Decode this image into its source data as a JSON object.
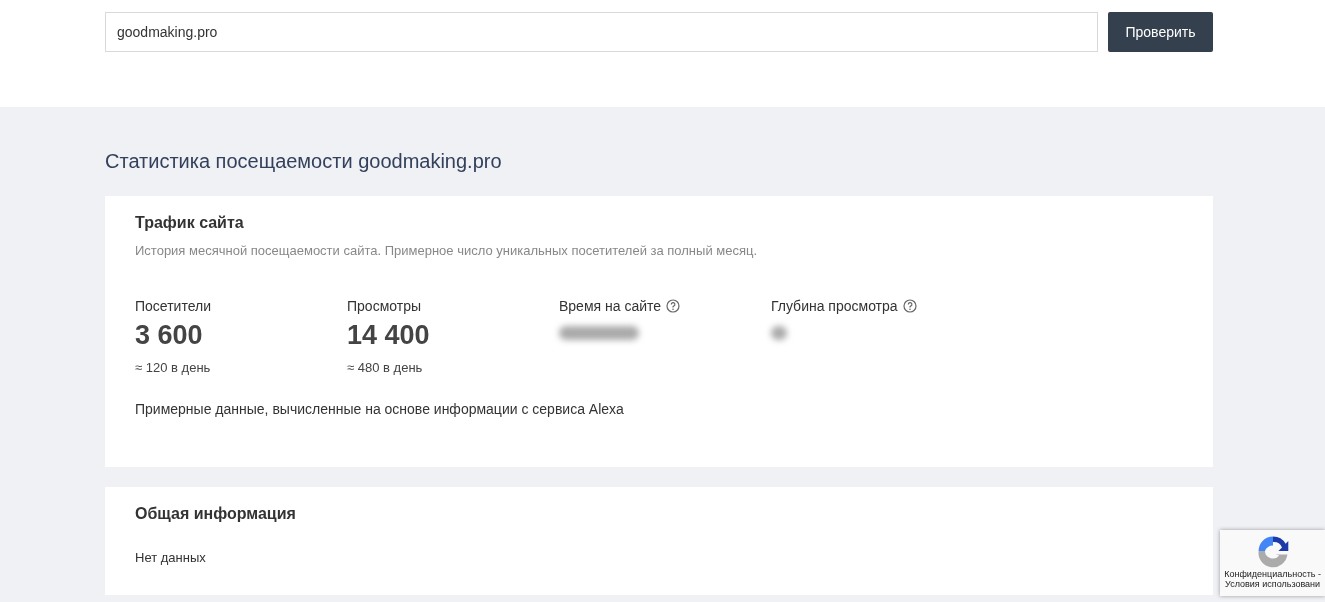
{
  "search": {
    "value": "goodmaking.pro",
    "button": "Проверить"
  },
  "heading": "Статистика посещаемости goodmaking.pro",
  "traffic": {
    "title": "Трафик сайта",
    "description": "История месячной посещаемости сайта. Примерное число уникальных посетителей за полный месяц.",
    "metrics": [
      {
        "kind": "value",
        "label": "Посетители",
        "value": "3 600",
        "note": "≈ 120 в день"
      },
      {
        "kind": "value",
        "label": "Просмотры",
        "value": "14 400",
        "note": "≈ 480 в день"
      },
      {
        "kind": "blurred",
        "label": "Время на сайте"
      },
      {
        "kind": "blurred",
        "label": "Глубина просмотра"
      }
    ],
    "footnote": "Примерные данные, вычисленные на основе информации с сервиса Alexa"
  },
  "general": {
    "title": "Общая информация",
    "text": "Нет данных"
  },
  "recaptcha": {
    "lines": [
      "Конфиденциальность -",
      "Условия использовани"
    ]
  }
}
